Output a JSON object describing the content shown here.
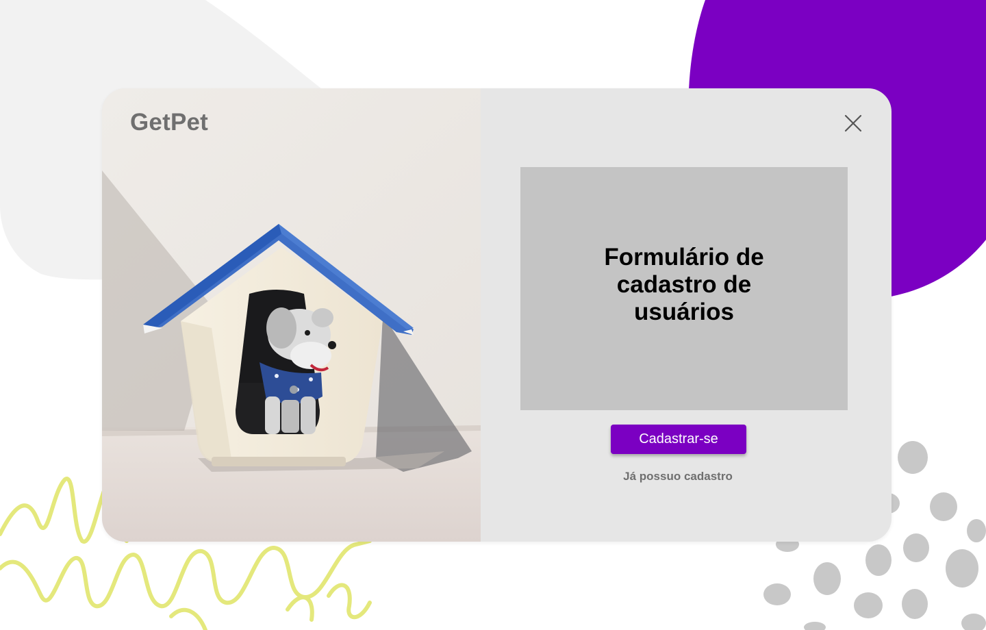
{
  "app": {
    "brand": "GetPet"
  },
  "form_area": {
    "placeholder_text": "Formulário de cadastro de usuários"
  },
  "actions": {
    "signup_label": "Cadastrar-se",
    "login_label": "Já possuo cadastro"
  },
  "icons": {
    "close": "close-icon"
  },
  "colors": {
    "accent": "#7b00c2",
    "modal_background": "#e6e6e6",
    "placeholder_background": "#c4c4c4",
    "brand_text": "#6f6f6f",
    "decor_gray_blob": "#f2f2f2",
    "decor_yellow_squiggle": "#e4e87c",
    "decor_spots": "#c8c8c8"
  }
}
